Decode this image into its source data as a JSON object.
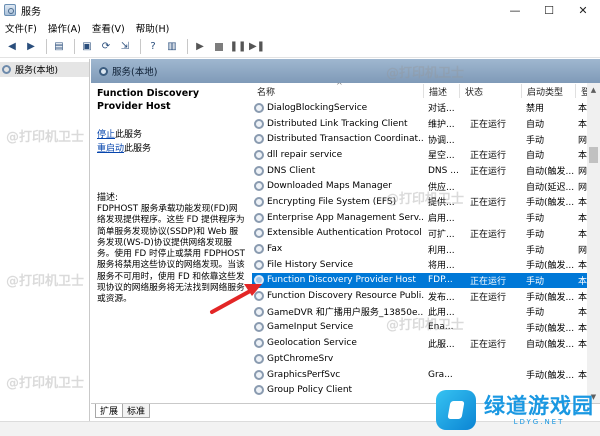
{
  "window": {
    "title": "服务",
    "minimize": "—",
    "maximize": "☐",
    "close": "✕"
  },
  "menu": [
    "文件(F)",
    "操作(A)",
    "查看(V)",
    "帮助(H)"
  ],
  "tree": {
    "root": "服务(本地)"
  },
  "pane": {
    "header": "服务(本地)"
  },
  "detail": {
    "service_name": "Function Discovery Provider Host",
    "stop_link": "停止",
    "stop_suffix": "此服务",
    "restart_link": "重启动",
    "restart_suffix": "此服务",
    "desc_label": "描述:",
    "description": "FDPHOST 服务承载功能发现(FD)网络发现提供程序。这些 FD 提供程序为简单服务发现协议(SSDP)和 Web 服务发现(WS-D)协议提供网络发现服务。使用 FD 时停止或禁用 FDPHOST 服务将禁用这些协议的网络发现。当该服务不可用时，使用 FD 和依靠这些发现协议的网络服务将无法找到网络服务或资源。"
  },
  "list": {
    "columns": {
      "name": "名称",
      "desc": "描述",
      "status": "状态",
      "startup": "启动类型",
      "logon": "登"
    },
    "sort_glyph": "^",
    "rows": [
      {
        "name": "DialogBlockingService",
        "desc": "对话...",
        "status": "",
        "startup": "禁用",
        "logon": "本"
      },
      {
        "name": "Distributed Link Tracking Client",
        "desc": "维护...",
        "status": "正在运行",
        "startup": "自动",
        "logon": "本"
      },
      {
        "name": "Distributed Transaction Coordinat...",
        "desc": "协调...",
        "status": "",
        "startup": "手动",
        "logon": "网"
      },
      {
        "name": "dll repair service",
        "desc": "星空...",
        "status": "正在运行",
        "startup": "自动",
        "logon": "本"
      },
      {
        "name": "DNS Client",
        "desc": "DNS ...",
        "status": "正在运行",
        "startup": "自动(触发...",
        "logon": "网"
      },
      {
        "name": "Downloaded Maps Manager",
        "desc": "供应...",
        "status": "",
        "startup": "自动(延迟...",
        "logon": "网"
      },
      {
        "name": "Encrypting File System (EFS)",
        "desc": "提供...",
        "status": "正在运行",
        "startup": "手动(触发...",
        "logon": "本"
      },
      {
        "name": "Enterprise App Management Serv...",
        "desc": "启用...",
        "status": "",
        "startup": "手动",
        "logon": "本"
      },
      {
        "name": "Extensible Authentication Protocol",
        "desc": "可扩...",
        "status": "正在运行",
        "startup": "手动",
        "logon": "本"
      },
      {
        "name": "Fax",
        "desc": "利用...",
        "status": "",
        "startup": "手动",
        "logon": "网"
      },
      {
        "name": "File History Service",
        "desc": "将用...",
        "status": "",
        "startup": "手动(触发...",
        "logon": "本"
      },
      {
        "name": "Function Discovery Provider Host",
        "desc": "FDP...",
        "status": "正在运行",
        "startup": "手动",
        "logon": "本",
        "selected": true
      },
      {
        "name": "Function Discovery Resource Publi...",
        "desc": "发布...",
        "status": "正在运行",
        "startup": "手动(触发...",
        "logon": "本"
      },
      {
        "name": "GameDVR 和广播用户服务_13850e...",
        "desc": "此用...",
        "status": "",
        "startup": "手动",
        "logon": "本"
      },
      {
        "name": "GameInput Service",
        "desc": "Ena...",
        "status": "",
        "startup": "手动(触发...",
        "logon": "本"
      },
      {
        "name": "Geolocation Service",
        "desc": "此服...",
        "status": "正在运行",
        "startup": "自动(触发...",
        "logon": "本"
      },
      {
        "name": "GptChromeSrv",
        "desc": "",
        "status": "",
        "startup": "",
        "logon": ""
      },
      {
        "name": "GraphicsPerfSvc",
        "desc": "Gra...",
        "status": "",
        "startup": "手动(触发...",
        "logon": "本"
      },
      {
        "name": "Group Policy Client",
        "desc": "",
        "status": "",
        "startup": "",
        "logon": ""
      }
    ]
  },
  "tabs": [
    "扩展",
    "标准"
  ],
  "watermark": "@打印机卫士",
  "logo": {
    "cn": "绿道游戏园",
    "en": "LDYG.NET"
  },
  "colors": {
    "selection": "#0078d7",
    "header_gradient": "#9fb7d0",
    "link": "#0645ad",
    "arrow": "#e32626"
  }
}
